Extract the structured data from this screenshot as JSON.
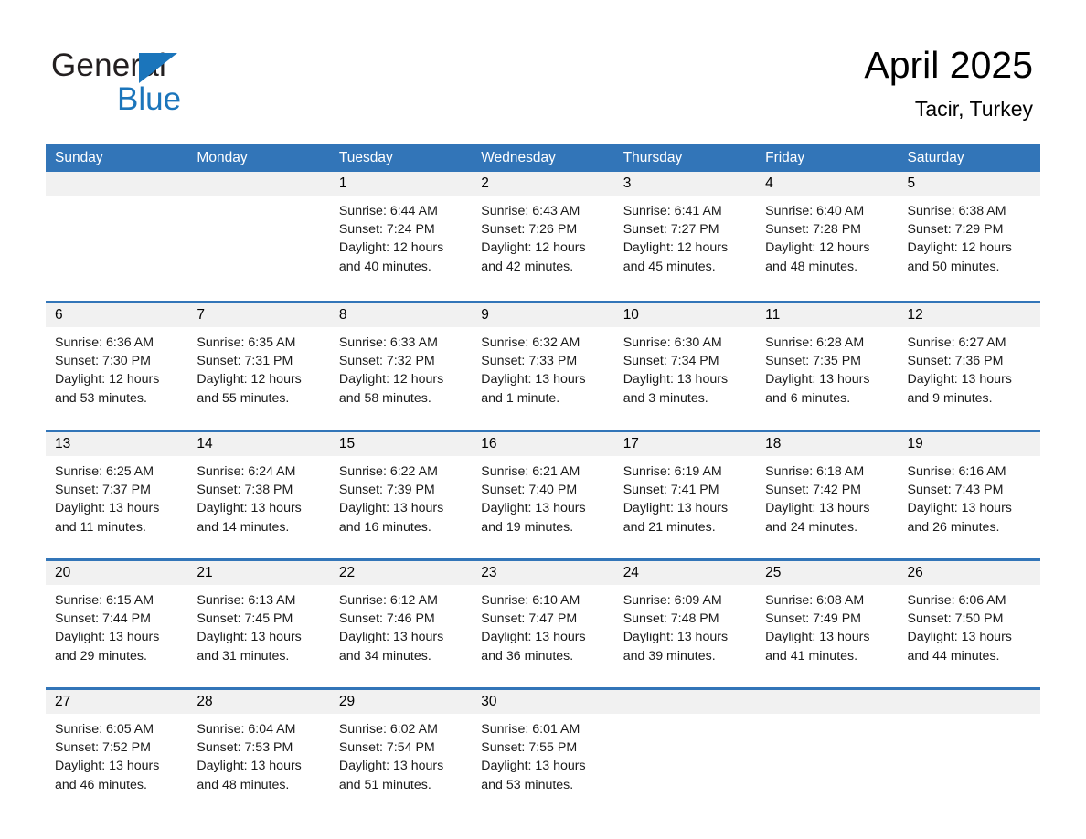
{
  "brand": {
    "line1": "General",
    "line2": "Blue",
    "triangle_icon": "triangle-icon",
    "accent_color": "#1b75bb"
  },
  "header": {
    "title": "April 2025",
    "subtitle": "Tacir, Turkey"
  },
  "theme": {
    "header_blue": "#3275b8",
    "daynum_band": "#f1f1f1",
    "text": "#000000"
  },
  "weekdays": [
    "Sunday",
    "Monday",
    "Tuesday",
    "Wednesday",
    "Thursday",
    "Friday",
    "Saturday"
  ],
  "weeks": [
    [
      {
        "day": "",
        "empty": true
      },
      {
        "day": "",
        "empty": true
      },
      {
        "day": "1",
        "sunrise": "Sunrise: 6:44 AM",
        "sunset": "Sunset: 7:24 PM",
        "daylight": "Daylight: 12 hours and 40 minutes."
      },
      {
        "day": "2",
        "sunrise": "Sunrise: 6:43 AM",
        "sunset": "Sunset: 7:26 PM",
        "daylight": "Daylight: 12 hours and 42 minutes."
      },
      {
        "day": "3",
        "sunrise": "Sunrise: 6:41 AM",
        "sunset": "Sunset: 7:27 PM",
        "daylight": "Daylight: 12 hours and 45 minutes."
      },
      {
        "day": "4",
        "sunrise": "Sunrise: 6:40 AM",
        "sunset": "Sunset: 7:28 PM",
        "daylight": "Daylight: 12 hours and 48 minutes."
      },
      {
        "day": "5",
        "sunrise": "Sunrise: 6:38 AM",
        "sunset": "Sunset: 7:29 PM",
        "daylight": "Daylight: 12 hours and 50 minutes."
      }
    ],
    [
      {
        "day": "6",
        "sunrise": "Sunrise: 6:36 AM",
        "sunset": "Sunset: 7:30 PM",
        "daylight": "Daylight: 12 hours and 53 minutes."
      },
      {
        "day": "7",
        "sunrise": "Sunrise: 6:35 AM",
        "sunset": "Sunset: 7:31 PM",
        "daylight": "Daylight: 12 hours and 55 minutes."
      },
      {
        "day": "8",
        "sunrise": "Sunrise: 6:33 AM",
        "sunset": "Sunset: 7:32 PM",
        "daylight": "Daylight: 12 hours and 58 minutes."
      },
      {
        "day": "9",
        "sunrise": "Sunrise: 6:32 AM",
        "sunset": "Sunset: 7:33 PM",
        "daylight": "Daylight: 13 hours and 1 minute."
      },
      {
        "day": "10",
        "sunrise": "Sunrise: 6:30 AM",
        "sunset": "Sunset: 7:34 PM",
        "daylight": "Daylight: 13 hours and 3 minutes."
      },
      {
        "day": "11",
        "sunrise": "Sunrise: 6:28 AM",
        "sunset": "Sunset: 7:35 PM",
        "daylight": "Daylight: 13 hours and 6 minutes."
      },
      {
        "day": "12",
        "sunrise": "Sunrise: 6:27 AM",
        "sunset": "Sunset: 7:36 PM",
        "daylight": "Daylight: 13 hours and 9 minutes."
      }
    ],
    [
      {
        "day": "13",
        "sunrise": "Sunrise: 6:25 AM",
        "sunset": "Sunset: 7:37 PM",
        "daylight": "Daylight: 13 hours and 11 minutes."
      },
      {
        "day": "14",
        "sunrise": "Sunrise: 6:24 AM",
        "sunset": "Sunset: 7:38 PM",
        "daylight": "Daylight: 13 hours and 14 minutes."
      },
      {
        "day": "15",
        "sunrise": "Sunrise: 6:22 AM",
        "sunset": "Sunset: 7:39 PM",
        "daylight": "Daylight: 13 hours and 16 minutes."
      },
      {
        "day": "16",
        "sunrise": "Sunrise: 6:21 AM",
        "sunset": "Sunset: 7:40 PM",
        "daylight": "Daylight: 13 hours and 19 minutes."
      },
      {
        "day": "17",
        "sunrise": "Sunrise: 6:19 AM",
        "sunset": "Sunset: 7:41 PM",
        "daylight": "Daylight: 13 hours and 21 minutes."
      },
      {
        "day": "18",
        "sunrise": "Sunrise: 6:18 AM",
        "sunset": "Sunset: 7:42 PM",
        "daylight": "Daylight: 13 hours and 24 minutes."
      },
      {
        "day": "19",
        "sunrise": "Sunrise: 6:16 AM",
        "sunset": "Sunset: 7:43 PM",
        "daylight": "Daylight: 13 hours and 26 minutes."
      }
    ],
    [
      {
        "day": "20",
        "sunrise": "Sunrise: 6:15 AM",
        "sunset": "Sunset: 7:44 PM",
        "daylight": "Daylight: 13 hours and 29 minutes."
      },
      {
        "day": "21",
        "sunrise": "Sunrise: 6:13 AM",
        "sunset": "Sunset: 7:45 PM",
        "daylight": "Daylight: 13 hours and 31 minutes."
      },
      {
        "day": "22",
        "sunrise": "Sunrise: 6:12 AM",
        "sunset": "Sunset: 7:46 PM",
        "daylight": "Daylight: 13 hours and 34 minutes."
      },
      {
        "day": "23",
        "sunrise": "Sunrise: 6:10 AM",
        "sunset": "Sunset: 7:47 PM",
        "daylight": "Daylight: 13 hours and 36 minutes."
      },
      {
        "day": "24",
        "sunrise": "Sunrise: 6:09 AM",
        "sunset": "Sunset: 7:48 PM",
        "daylight": "Daylight: 13 hours and 39 minutes."
      },
      {
        "day": "25",
        "sunrise": "Sunrise: 6:08 AM",
        "sunset": "Sunset: 7:49 PM",
        "daylight": "Daylight: 13 hours and 41 minutes."
      },
      {
        "day": "26",
        "sunrise": "Sunrise: 6:06 AM",
        "sunset": "Sunset: 7:50 PM",
        "daylight": "Daylight: 13 hours and 44 minutes."
      }
    ],
    [
      {
        "day": "27",
        "sunrise": "Sunrise: 6:05 AM",
        "sunset": "Sunset: 7:52 PM",
        "daylight": "Daylight: 13 hours and 46 minutes."
      },
      {
        "day": "28",
        "sunrise": "Sunrise: 6:04 AM",
        "sunset": "Sunset: 7:53 PM",
        "daylight": "Daylight: 13 hours and 48 minutes."
      },
      {
        "day": "29",
        "sunrise": "Sunrise: 6:02 AM",
        "sunset": "Sunset: 7:54 PM",
        "daylight": "Daylight: 13 hours and 51 minutes."
      },
      {
        "day": "30",
        "sunrise": "Sunrise: 6:01 AM",
        "sunset": "Sunset: 7:55 PM",
        "daylight": "Daylight: 13 hours and 53 minutes."
      },
      {
        "day": "",
        "empty": true
      },
      {
        "day": "",
        "empty": true
      },
      {
        "day": "",
        "empty": true
      }
    ]
  ]
}
